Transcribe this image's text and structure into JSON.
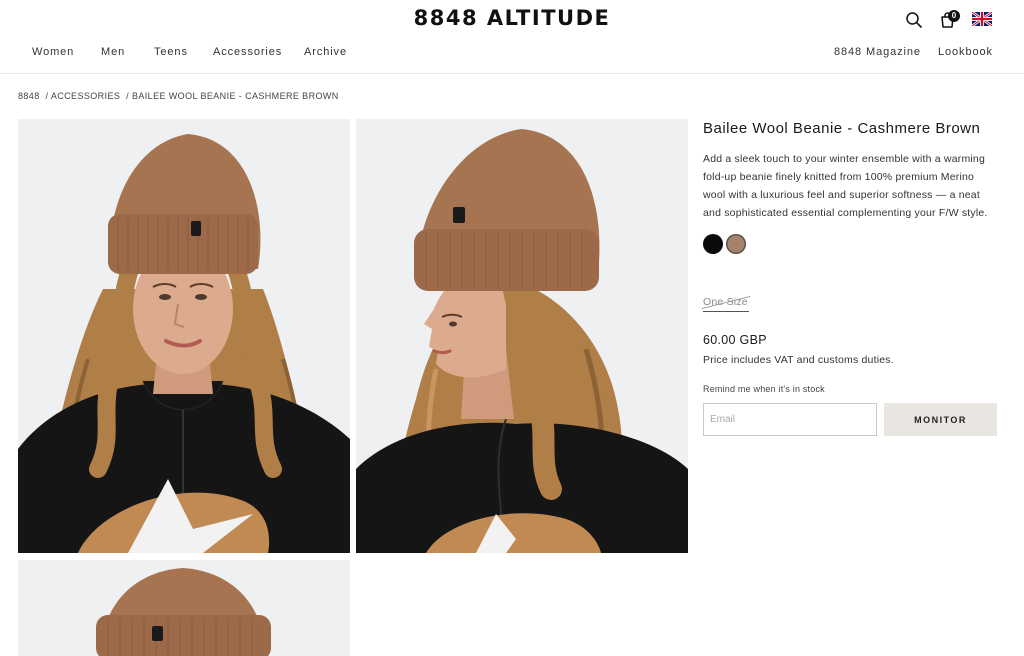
{
  "brand": {
    "logo": "8848 ALTITUDE"
  },
  "nav": {
    "left": [
      "Women",
      "Men",
      "Teens",
      "Accessories",
      "Archive"
    ],
    "right": [
      "8848 Magazine",
      "Lookbook"
    ]
  },
  "header": {
    "cart_count": "0",
    "icons": [
      "search-icon",
      "cart-icon",
      "uk-flag-icon"
    ]
  },
  "breadcrumb": [
    "8848",
    "/ ACCESSORIES",
    "/ BAILEE WOOL BEANIE - CASHMERE BROWN"
  ],
  "product": {
    "title": "Bailee Wool Beanie - Cashmere Brown",
    "description": "Add a sleek touch to your winter ensemble with a warming fold-up beanie finely knitted from 100% premium Merino wool with a luxurious feel and superior softness — a neat and sophisticated essential complementing your F/W style.",
    "colors": [
      {
        "name": "black",
        "hex": "#0a0a0a"
      },
      {
        "name": "cashmere-brown",
        "hex": "#a5826a"
      }
    ],
    "size": "One Size",
    "price": "60.00 GBP",
    "vat_note": "Price includes VAT and customs duties.",
    "remind_label": "Remind me when it's in stock",
    "email_placeholder": "Email",
    "monitor_label": "MONITOR"
  },
  "colors": {
    "beanie": "#a67450",
    "hair": "#b07f48",
    "skin": "#dcab8e",
    "jacket": "#151515",
    "print": "#c08a52",
    "photo_bg": "#eef0f2"
  }
}
